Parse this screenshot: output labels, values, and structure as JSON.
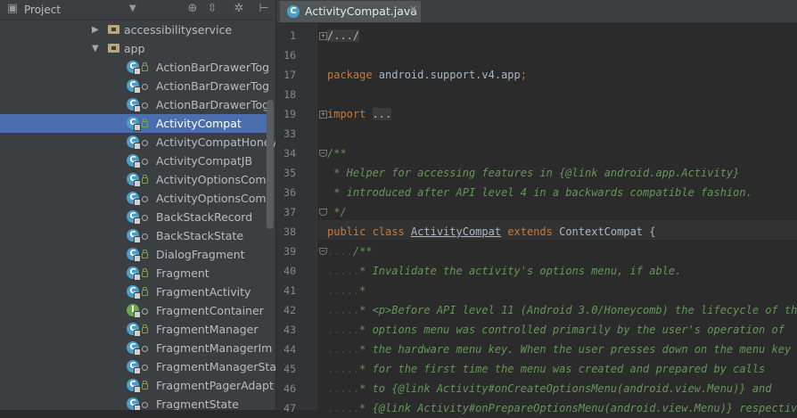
{
  "project_panel": {
    "title": "Project",
    "dropdown_icon": "chevron-down-icon",
    "toolbar_icons": [
      "target-icon",
      "collapse-icon",
      "gear-icon",
      "hide-panel-icon"
    ]
  },
  "tree": [
    {
      "label": "accessibilityservice",
      "kind": "package",
      "indent": 1,
      "expanded": false
    },
    {
      "label": "app",
      "kind": "package",
      "indent": 1,
      "expanded": true
    },
    {
      "label": "ActionBarDrawerTog",
      "kind": "class",
      "vis": "lock"
    },
    {
      "label": "ActionBarDrawerTog",
      "kind": "class",
      "vis": "dot"
    },
    {
      "label": "ActionBarDrawerTog",
      "kind": "class",
      "vis": "dot"
    },
    {
      "label": "ActivityCompat",
      "kind": "class",
      "vis": "lock",
      "selected": true
    },
    {
      "label": "ActivityCompatHoney",
      "kind": "class",
      "vis": "dot"
    },
    {
      "label": "ActivityCompatJB",
      "kind": "class",
      "vis": "dot"
    },
    {
      "label": "ActivityOptionsComp",
      "kind": "class",
      "vis": "lock"
    },
    {
      "label": "ActivityOptionsComp",
      "kind": "class",
      "vis": "dot"
    },
    {
      "label": "BackStackRecord",
      "kind": "class",
      "vis": "dot"
    },
    {
      "label": "BackStackState",
      "kind": "class",
      "vis": "dot"
    },
    {
      "label": "DialogFragment",
      "kind": "class",
      "vis": "lock"
    },
    {
      "label": "Fragment",
      "kind": "class",
      "vis": "lock"
    },
    {
      "label": "FragmentActivity",
      "kind": "class",
      "vis": "lock"
    },
    {
      "label": "FragmentContainer",
      "kind": "interface",
      "vis": "dot"
    },
    {
      "label": "FragmentManager",
      "kind": "class",
      "vis": "lock"
    },
    {
      "label": "FragmentManagerIm",
      "kind": "class",
      "vis": "dot"
    },
    {
      "label": "FragmentManagerSta",
      "kind": "class",
      "vis": "dot"
    },
    {
      "label": "FragmentPagerAdapt",
      "kind": "class",
      "vis": "lock"
    },
    {
      "label": "FragmentState",
      "kind": "class",
      "vis": "dot"
    }
  ],
  "editor": {
    "tab_name": "ActivityCompat.java",
    "tab_icon_letter": "C",
    "lines": [
      {
        "n": "1",
        "fold": "plus",
        "parts": [
          {
            "t": "/.../",
            "c": "fd"
          }
        ]
      },
      {
        "n": "16",
        "parts": []
      },
      {
        "n": "17",
        "parts": [
          {
            "t": "package ",
            "c": "kw"
          },
          {
            "t": "android.support.v4.app",
            "c": ""
          },
          {
            "t": ";",
            "c": "kw"
          }
        ]
      },
      {
        "n": "18",
        "parts": []
      },
      {
        "n": "19",
        "fold": "plus",
        "parts": [
          {
            "t": "import ",
            "c": "kw"
          },
          {
            "t": "...",
            "c": "fd"
          }
        ]
      },
      {
        "n": "33",
        "parts": []
      },
      {
        "n": "34",
        "fold": "minus",
        "parts": [
          {
            "t": "/**",
            "c": "cm"
          }
        ]
      },
      {
        "n": "35",
        "parts": [
          {
            "t": " * Helper for accessing features in {@link android.app.Activity}",
            "c": "cm"
          }
        ]
      },
      {
        "n": "36",
        "parts": [
          {
            "t": " * introduced after API level 4 in a backwards compatible fashion.",
            "c": "cm"
          }
        ]
      },
      {
        "n": "37",
        "fold": "end",
        "parts": [
          {
            "t": " */",
            "c": "cm"
          }
        ]
      },
      {
        "n": "38",
        "parts": [
          {
            "t": "public class ",
            "c": "kw"
          },
          {
            "t": "ActivityCompat",
            "c": "ul"
          },
          {
            "t": " extends ",
            "c": "kw"
          },
          {
            "t": "ContextCompat {",
            "c": ""
          }
        ]
      },
      {
        "n": "39",
        "fold": "minus",
        "parts": [
          {
            "t": "....",
            "c": "ws"
          },
          {
            "t": "/**",
            "c": "cm"
          }
        ]
      },
      {
        "n": "40",
        "parts": [
          {
            "t": ".....",
            "c": "ws"
          },
          {
            "t": "* Invalidate the activity's options menu, if able.",
            "c": "cm"
          }
        ]
      },
      {
        "n": "41",
        "parts": [
          {
            "t": ".....",
            "c": "ws"
          },
          {
            "t": "*",
            "c": "cm"
          }
        ]
      },
      {
        "n": "42",
        "parts": [
          {
            "t": ".....",
            "c": "ws"
          },
          {
            "t": "* <p>Before API level 11 (Android 3.0/Honeycomb) the lifecycle of the",
            "c": "cm"
          }
        ]
      },
      {
        "n": "43",
        "parts": [
          {
            "t": ".....",
            "c": "ws"
          },
          {
            "t": "* options menu was controlled primarily by the user's operation of",
            "c": "cm"
          }
        ]
      },
      {
        "n": "44",
        "parts": [
          {
            "t": ".....",
            "c": "ws"
          },
          {
            "t": "* the hardware menu key. When the user presses down on the menu key",
            "c": "cm"
          }
        ]
      },
      {
        "n": "45",
        "parts": [
          {
            "t": ".....",
            "c": "ws"
          },
          {
            "t": "* for the first time the menu was created and prepared by calls",
            "c": "cm"
          }
        ]
      },
      {
        "n": "46",
        "parts": [
          {
            "t": ".....",
            "c": "ws"
          },
          {
            "t": "* to {@link Activity#onCreateOptionsMenu(android.view.Menu)} and",
            "c": "cm"
          }
        ]
      },
      {
        "n": "47",
        "parts": [
          {
            "t": ".....",
            "c": "ws"
          },
          {
            "t": "* {@link Activity#onPrepareOptionsMenu(android.view.Menu)} respectively.",
            "c": "cm"
          }
        ]
      }
    ]
  },
  "colors": {
    "selection": "#4b6eaf",
    "keyword": "#cc7832",
    "comment": "#629755",
    "background": "#2b2b2b"
  }
}
